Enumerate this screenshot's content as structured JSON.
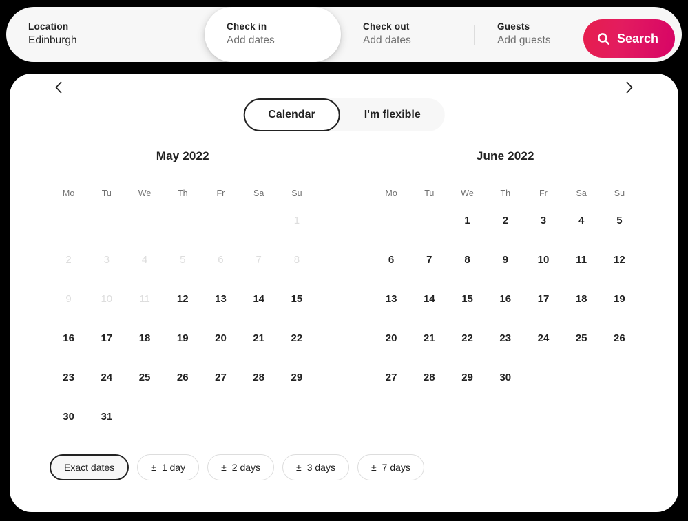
{
  "accent": {
    "brand_gradient_from": "#E61E4D",
    "brand_gradient_to": "#D70466",
    "text_primary": "#222222",
    "text_muted": "#717171",
    "text_disabled": "#DDDDDD",
    "surface": "#F7F7F7"
  },
  "searchbar": {
    "location": {
      "label": "Location",
      "value": "Edinburgh"
    },
    "checkin": {
      "label": "Check in",
      "value": "Add dates",
      "placeholder": "Add dates",
      "active": true
    },
    "checkout": {
      "label": "Check out",
      "value": "Add dates",
      "placeholder": "Add dates"
    },
    "guests": {
      "label": "Guests",
      "value": "Add guests",
      "placeholder": "Add guests"
    },
    "search_button": {
      "label": "Search",
      "icon": "search-icon"
    }
  },
  "panel": {
    "mode_tabs": [
      {
        "label": "Calendar",
        "active": true
      },
      {
        "label": "I'm flexible",
        "active": false
      }
    ],
    "nav": {
      "prev_icon": "chevron-left-icon",
      "next_icon": "chevron-right-icon"
    },
    "weekdays": [
      "Mo",
      "Tu",
      "We",
      "Th",
      "Fr",
      "Sa",
      "Su"
    ],
    "months": [
      {
        "title": "May 2022",
        "lead_blanks": 6,
        "days": [
          {
            "n": "1",
            "disabled": true
          },
          {
            "n": "2",
            "disabled": true
          },
          {
            "n": "3",
            "disabled": true
          },
          {
            "n": "4",
            "disabled": true
          },
          {
            "n": "5",
            "disabled": true
          },
          {
            "n": "6",
            "disabled": true
          },
          {
            "n": "7",
            "disabled": true
          },
          {
            "n": "8",
            "disabled": true
          },
          {
            "n": "9",
            "disabled": true
          },
          {
            "n": "10",
            "disabled": true
          },
          {
            "n": "11",
            "disabled": true
          },
          {
            "n": "12",
            "disabled": false
          },
          {
            "n": "13",
            "disabled": false
          },
          {
            "n": "14",
            "disabled": false
          },
          {
            "n": "15",
            "disabled": false
          },
          {
            "n": "16",
            "disabled": false
          },
          {
            "n": "17",
            "disabled": false
          },
          {
            "n": "18",
            "disabled": false
          },
          {
            "n": "19",
            "disabled": false
          },
          {
            "n": "20",
            "disabled": false
          },
          {
            "n": "21",
            "disabled": false
          },
          {
            "n": "22",
            "disabled": false
          },
          {
            "n": "23",
            "disabled": false
          },
          {
            "n": "24",
            "disabled": false
          },
          {
            "n": "25",
            "disabled": false
          },
          {
            "n": "26",
            "disabled": false
          },
          {
            "n": "27",
            "disabled": false
          },
          {
            "n": "28",
            "disabled": false
          },
          {
            "n": "29",
            "disabled": false
          },
          {
            "n": "30",
            "disabled": false
          },
          {
            "n": "31",
            "disabled": false
          }
        ]
      },
      {
        "title": "June 2022",
        "lead_blanks": 2,
        "days": [
          {
            "n": "1",
            "disabled": false
          },
          {
            "n": "2",
            "disabled": false
          },
          {
            "n": "3",
            "disabled": false
          },
          {
            "n": "4",
            "disabled": false
          },
          {
            "n": "5",
            "disabled": false
          },
          {
            "n": "6",
            "disabled": false
          },
          {
            "n": "7",
            "disabled": false
          },
          {
            "n": "8",
            "disabled": false
          },
          {
            "n": "9",
            "disabled": false
          },
          {
            "n": "10",
            "disabled": false
          },
          {
            "n": "11",
            "disabled": false
          },
          {
            "n": "12",
            "disabled": false
          },
          {
            "n": "13",
            "disabled": false
          },
          {
            "n": "14",
            "disabled": false
          },
          {
            "n": "15",
            "disabled": false
          },
          {
            "n": "16",
            "disabled": false
          },
          {
            "n": "17",
            "disabled": false
          },
          {
            "n": "18",
            "disabled": false
          },
          {
            "n": "19",
            "disabled": false
          },
          {
            "n": "20",
            "disabled": false
          },
          {
            "n": "21",
            "disabled": false
          },
          {
            "n": "22",
            "disabled": false
          },
          {
            "n": "23",
            "disabled": false
          },
          {
            "n": "24",
            "disabled": false
          },
          {
            "n": "25",
            "disabled": false
          },
          {
            "n": "26",
            "disabled": false
          },
          {
            "n": "27",
            "disabled": false
          },
          {
            "n": "28",
            "disabled": false
          },
          {
            "n": "29",
            "disabled": false
          },
          {
            "n": "30",
            "disabled": false
          }
        ]
      }
    ],
    "flexibility_chips": [
      {
        "pm": "",
        "label": "Exact dates",
        "selected": true
      },
      {
        "pm": "±",
        "label": "1 day",
        "selected": false
      },
      {
        "pm": "±",
        "label": "2 days",
        "selected": false
      },
      {
        "pm": "±",
        "label": "3 days",
        "selected": false
      },
      {
        "pm": "±",
        "label": "7 days",
        "selected": false
      }
    ]
  }
}
